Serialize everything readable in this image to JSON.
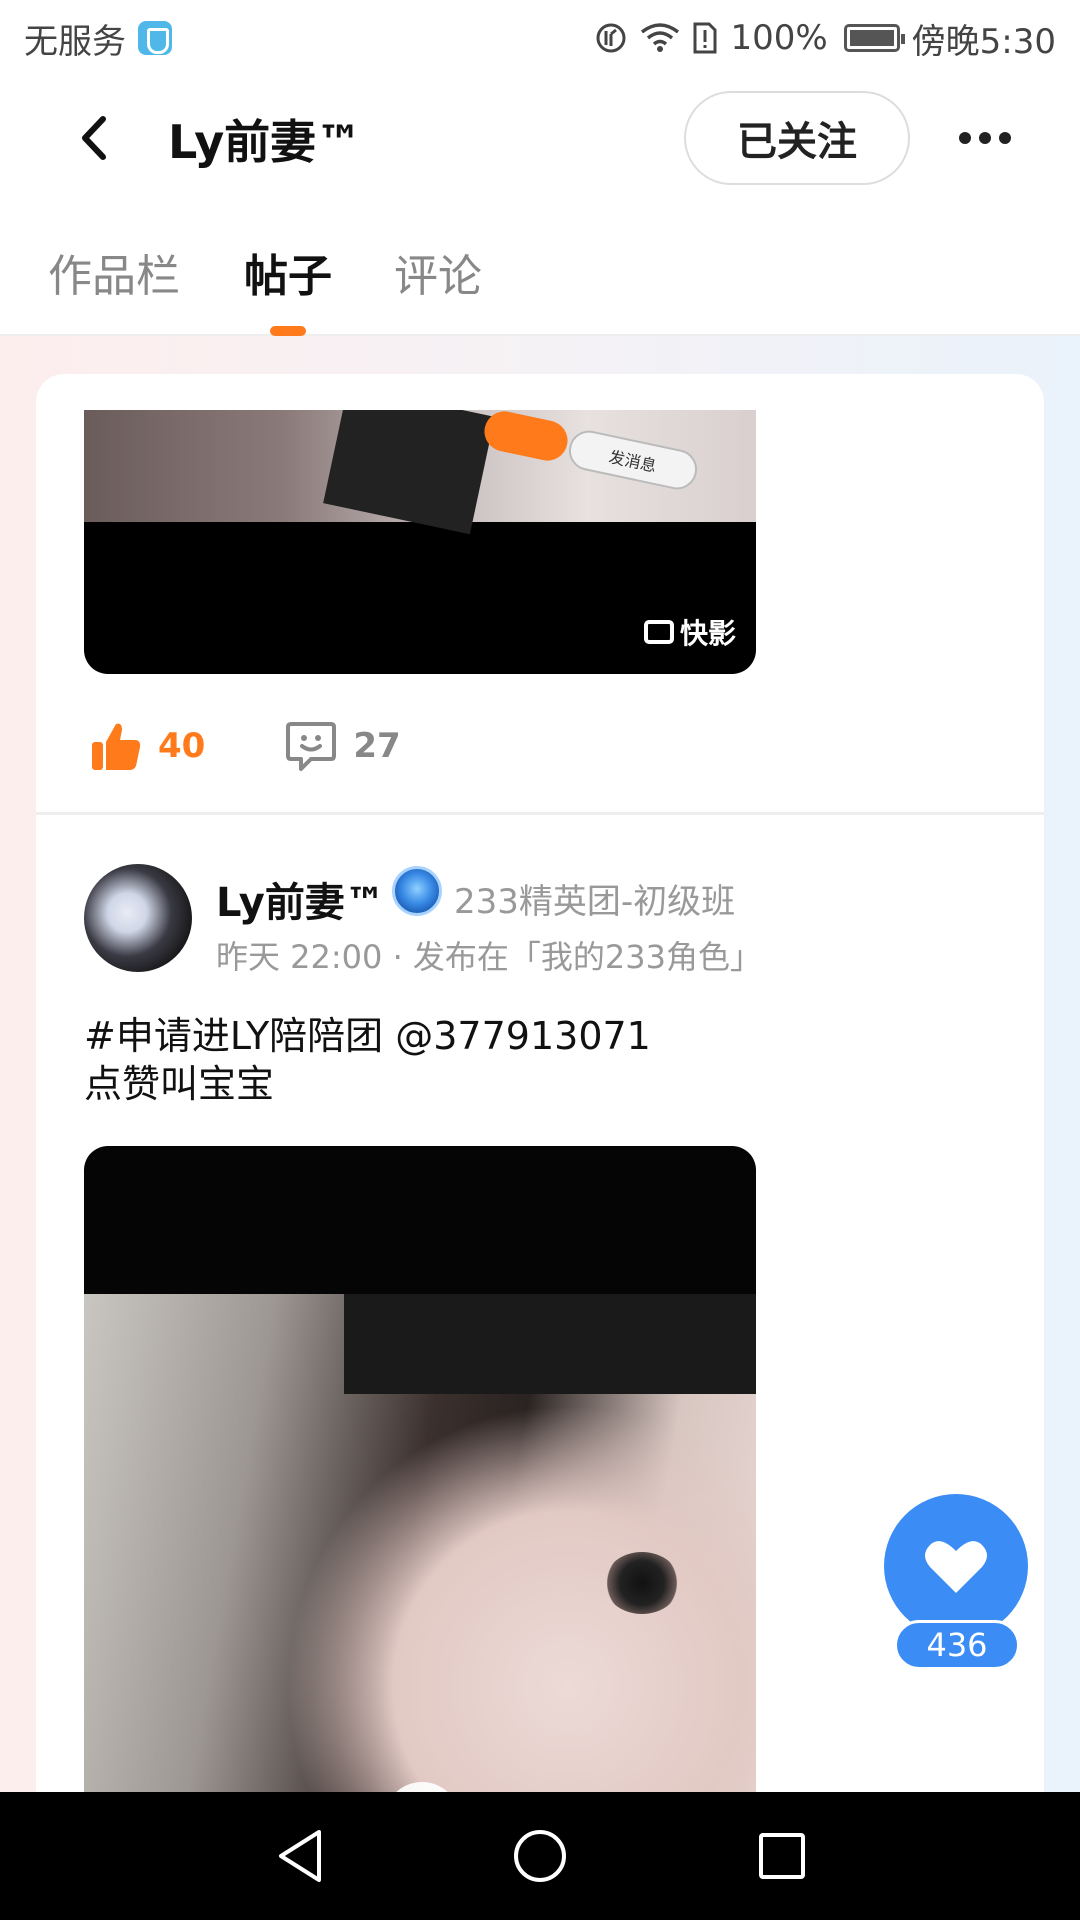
{
  "status_bar": {
    "carrier": "无服务",
    "battery": "100%",
    "time": "傍晚5:30"
  },
  "header": {
    "title": "Ly前妻™",
    "follow_label": "已关注"
  },
  "tabs": [
    {
      "label": "作品栏",
      "active": false
    },
    {
      "label": "帖子",
      "active": true
    },
    {
      "label": "评论",
      "active": false
    }
  ],
  "first_post": {
    "media_message_label": "发消息",
    "watermark": "快影",
    "likes": "40",
    "comments": "27"
  },
  "second_post": {
    "author": "Ly前妻™",
    "badge": "233精英团-初级班",
    "meta": "昨天 22:00 · 发布在「我的233角色」",
    "text_line1": "#申请进LY陪陪团  @377913071",
    "text_line2": "点赞叫宝宝"
  },
  "floating_like": {
    "count": "436"
  },
  "colors": {
    "accent_orange": "#ff7a1a",
    "heart_blue": "#3b8df5"
  }
}
